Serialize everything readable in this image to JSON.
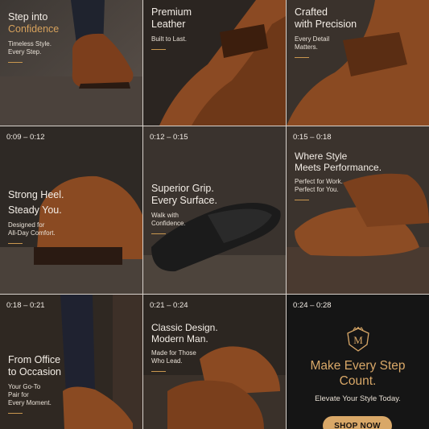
{
  "tiles": [
    {
      "headline_1": "Step into",
      "headline_accent": "Confidence",
      "subtext": "Timeless Style.\nEvery Step."
    },
    {
      "headline_1": "Premium",
      "headline_2": "Leather",
      "subtext": "Built to Last."
    },
    {
      "headline_1": "Crafted",
      "headline_2": "with Precision",
      "subtext": "Every Detail\nMatters."
    },
    {
      "timestamp": "0:09 – 0:12",
      "headline_1": "Strong Heel.",
      "headline_2": "Steady You.",
      "subtext": "Designed for\nAll-Day Comfort."
    },
    {
      "timestamp": "0:12 – 0:15",
      "headline_1": "Superior Grip.",
      "headline_2": "Every Surface.",
      "subtext": "Walk with\nConfidence."
    },
    {
      "timestamp": "0:15 – 0:18",
      "headline_1": "Where Style",
      "headline_2": "Meets Performance.",
      "subtext": "Perfect for Work.\nPerfect for You."
    },
    {
      "timestamp": "0:18 – 0:21",
      "headline_1": "From Office",
      "headline_2": "to Occasion",
      "subtext": "Your Go-To\nPair for\nEvery Moment."
    },
    {
      "timestamp": "0:21 – 0:24",
      "headline_1": "Classic Design.",
      "headline_2": "Modern Man.",
      "subtext": "Made for Those\nWho Lead."
    },
    {
      "timestamp": "0:24 – 0:28",
      "logo_letter": "M",
      "headline": "Make Every Step\nCount.",
      "subtext": "Elevate Your Style Today.",
      "cta_label": "SHOP NOW"
    }
  ],
  "colors": {
    "accent": "#d6a15c",
    "leather": "#8a4a22",
    "cta_bg": "#151515"
  },
  "icons": [
    "crest-logo-icon"
  ]
}
